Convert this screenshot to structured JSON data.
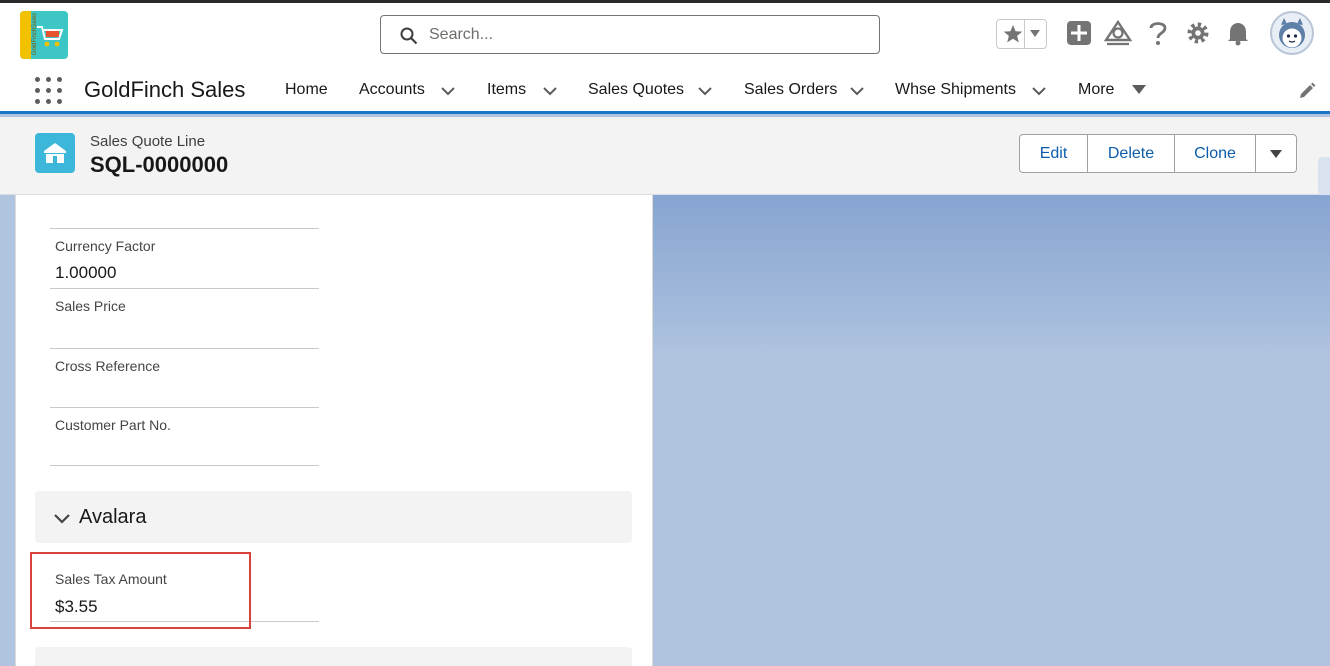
{
  "header": {
    "logo_text": "GoldFinchSales",
    "search_placeholder": "Search..."
  },
  "nav": {
    "app_name": "GoldFinch Sales",
    "items": [
      {
        "label": "Home",
        "has_menu": false
      },
      {
        "label": "Accounts",
        "has_menu": true
      },
      {
        "label": "Items",
        "has_menu": true
      },
      {
        "label": "Sales Quotes",
        "has_menu": true
      },
      {
        "label": "Sales Orders",
        "has_menu": true
      },
      {
        "label": "Whse Shipments",
        "has_menu": true
      },
      {
        "label": "More",
        "has_menu": true
      }
    ]
  },
  "record": {
    "object_type": "Sales Quote Line",
    "name": "SQL-0000000",
    "actions": [
      "Edit",
      "Delete",
      "Clone"
    ]
  },
  "fields": [
    {
      "label": "Currency Factor",
      "value": "1.00000"
    },
    {
      "label": "Sales Price",
      "value": ""
    },
    {
      "label": "Cross Reference",
      "value": ""
    },
    {
      "label": "Customer Part No.",
      "value": ""
    }
  ],
  "section": {
    "title": "Avalara",
    "fields": [
      {
        "label": "Sales Tax Amount",
        "value": "$3.55"
      }
    ]
  },
  "colors": {
    "brand_blue": "#1b76c9",
    "link_blue": "#0b5cab",
    "highlight_red": "#d9423a",
    "record_icon": "#3cb6d9"
  }
}
